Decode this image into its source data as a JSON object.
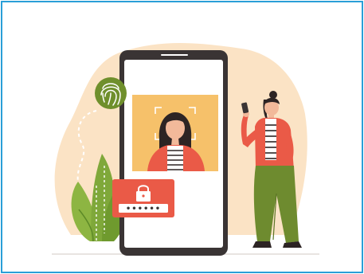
{
  "illustration": {
    "subject": "face-id-authentication",
    "colors": {
      "frame_border": "#2a9fd8",
      "background_blob": "#fbe3c5",
      "phone_body": "#3a3434",
      "phone_screen": "#ffffff",
      "face_scan_panel": "#f6c16a",
      "accent_red": "#ea5a47",
      "plant_green": "#7fa83a",
      "plant_dark_green": "#5d8a27",
      "fingerprint_green": "#6f8f2c",
      "pants_green": "#6e8b2f",
      "hair_dark": "#2d2424",
      "skin": "#f2b99a"
    },
    "icons": {
      "fingerprint": "fingerprint-icon",
      "lock": "padlock-icon",
      "scan_corners": "face-scan-frame-icon"
    }
  },
  "password_field": {
    "masked_value": "••••••"
  }
}
